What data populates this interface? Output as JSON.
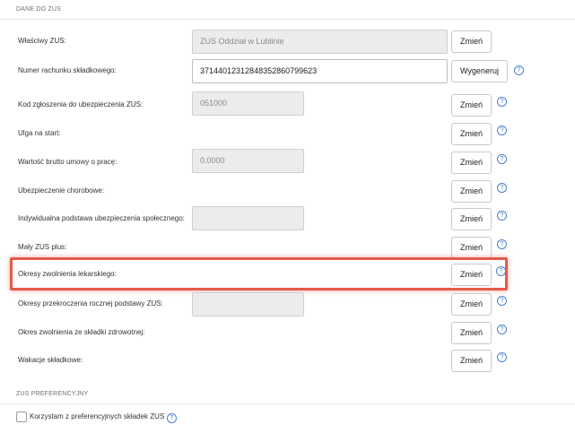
{
  "sections": {
    "zus_data": "DANE DO ZUS",
    "zus_pref": "ZUS PREFERENCYJNY"
  },
  "rows": {
    "wlasciwy_zus": {
      "label": "Właściwy ZUS:",
      "value": "ZUS Oddział w Lublinie",
      "button": "Zmień"
    },
    "numer_rachunku": {
      "label": "Numer rachunku składkowego:",
      "value": "37144012312848352860799623",
      "button": "Wygeneruj"
    },
    "kod_zgloszenia": {
      "label": "Kod zgłoszenia do ubezpieczenia ZUS:",
      "value": "051000",
      "button": "Zmień"
    },
    "ulga_na_start": {
      "label": "Ulga na start:",
      "button": "Zmień"
    },
    "wartosc_brutto": {
      "label": "Wartość brutto umowy o pracę:",
      "value": "0.0000",
      "button": "Zmień"
    },
    "ubezp_chorobowe": {
      "label": "Ubezpieczenie chorobowe:",
      "button": "Zmień"
    },
    "indywidualna_podstawa": {
      "label": "Indywidualna podstawa ubezpieczenia społecznego:",
      "value": "",
      "button": "Zmień"
    },
    "maly_zus": {
      "label": "Mały ZUS plus:",
      "button": "Zmień"
    },
    "okresy_zwolnienia": {
      "label": "Okresy zwolnienia lekarskiego:",
      "button": "Zmień"
    },
    "okresy_przekroczenia": {
      "label": "Okresy przekroczenia rocznej podstawy ZUS:",
      "value": "",
      "button": "Zmień"
    },
    "okres_zwolnienia_zdrow": {
      "label": "Okres zwolnienia ze składki zdrowotnej:",
      "button": "Zmień"
    },
    "wakacje": {
      "label": "Wakacje składkowe:",
      "button": "Zmień"
    }
  },
  "preferential": {
    "checkbox_label": "Korzystam z preferencyjnych składek ZUS"
  },
  "icons": {
    "info": "info-icon",
    "info_glyph": "?"
  },
  "colors": {
    "highlight": "#e35b4b",
    "info": "#4a7fd0"
  }
}
